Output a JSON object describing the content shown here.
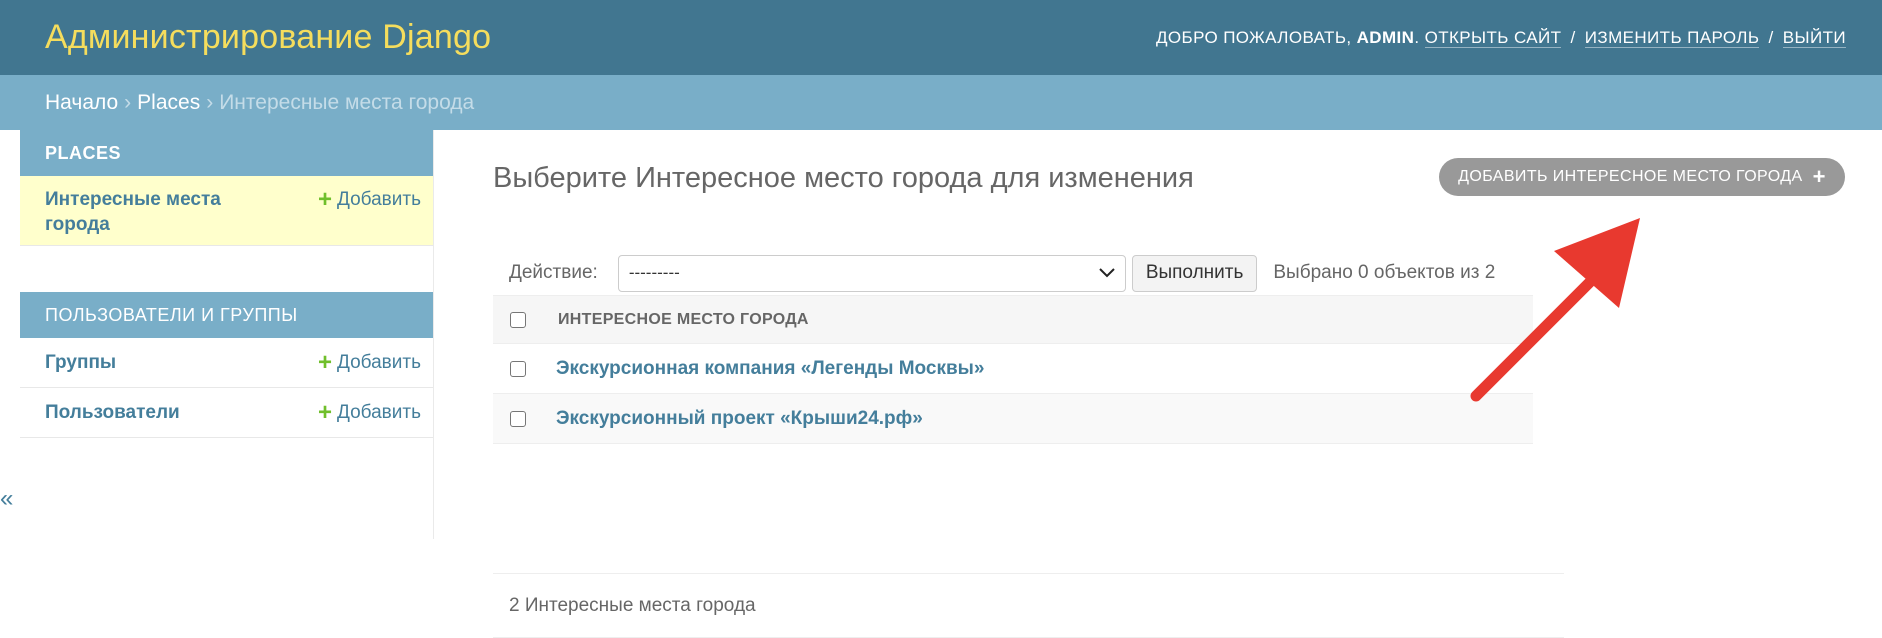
{
  "header": {
    "branding": "Администрирование Django",
    "welcome": "Добро пожаловать,",
    "username": "admin",
    "view_site": "Открыть сайт",
    "change_password": "Изменить пароль",
    "logout": "Выйти"
  },
  "breadcrumbs": {
    "home": "Начало",
    "app": "Places",
    "current": "Интересные места города",
    "separator": "›"
  },
  "sidebar": {
    "modules": [
      {
        "caption": "Places",
        "rows": [
          {
            "name": "Интересные места города",
            "add": "Добавить"
          }
        ]
      },
      {
        "caption": "Пользователи и группы",
        "rows": [
          {
            "name": "Группы",
            "add": "Добавить"
          },
          {
            "name": "Пользователи",
            "add": "Добавить"
          }
        ]
      }
    ],
    "collapse_glyph": "«"
  },
  "content": {
    "title": "Выберите Интересное место города для изменения",
    "add_button": "Добавить Интересное место города",
    "actions": {
      "label": "Действие:",
      "selected_option": "---------",
      "go": "Выполнить",
      "counter": "Выбрано 0 объектов из 2"
    },
    "table": {
      "header": "Интересное место города",
      "rows": [
        "Экскурсионная компания «Легенды Москвы»",
        "Экскурсионный проект «Крыши24.рф»"
      ]
    },
    "paginator": "2 Интересные места города"
  },
  "colors": {
    "header_bg": "#417690",
    "branding": "#f5dd5d",
    "breadcrumbs_bg": "#79aec8",
    "link": "#447e9b",
    "add_icon": "#70bf2b",
    "current_row_bg": "#ffffcc",
    "annotation_arrow": "#e8392f"
  }
}
